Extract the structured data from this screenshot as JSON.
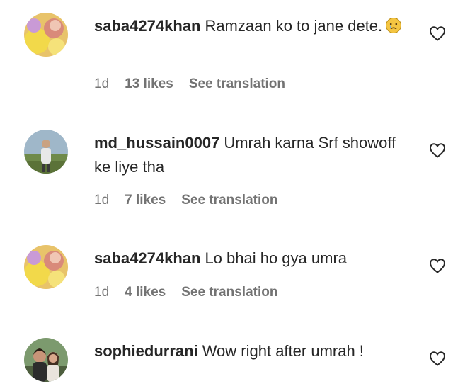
{
  "comments": [
    {
      "username": "saba4274khan",
      "text": "Ramzaan ko to jane dete.",
      "emoji": "crying-face",
      "time": "1d",
      "likes": "13 likes",
      "translate": "See translation",
      "avatar": "yellow-flower-avatar"
    },
    {
      "username": "md_hussain0007",
      "text": "Umrah karna Srf showoff ke liye tha",
      "time": "1d",
      "likes": "7 likes",
      "translate": "See translation",
      "avatar": "man-outdoor-avatar"
    },
    {
      "username": "saba4274khan",
      "text": "Lo bhai ho gya umra",
      "time": "1d",
      "likes": "4 likes",
      "translate": "See translation",
      "avatar": "yellow-flower-avatar"
    },
    {
      "username": "sophiedurrani",
      "text": "Wow right after umrah !",
      "avatar": "couple-avatar"
    }
  ],
  "colors": {
    "text": "#262626",
    "secondary": "#737373"
  }
}
